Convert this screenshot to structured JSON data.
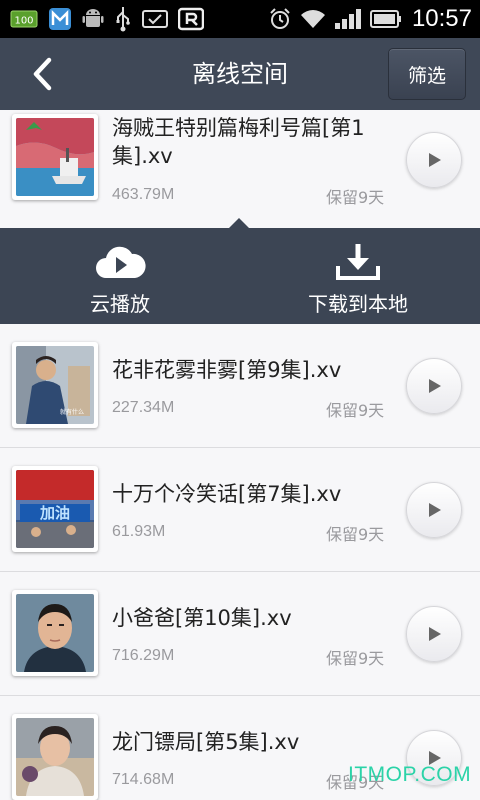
{
  "status_bar": {
    "battery_badge": "100",
    "time": "10:57"
  },
  "header": {
    "title": "离线空间",
    "filter_label": "筛选"
  },
  "action_panel": {
    "cloud_play_label": "云播放",
    "download_label": "下载到本地"
  },
  "items": [
    {
      "title": "海贼王特别篇梅利号篇[第1集].xv",
      "size": "463.79M",
      "keep": "保留9天"
    },
    {
      "title": "花非花雾非雾[第9集].xv",
      "size": "227.34M",
      "keep": "保留9天"
    },
    {
      "title": "十万个冷笑话[第7集].xv",
      "size": "61.93M",
      "keep": "保留9天"
    },
    {
      "title": "小爸爸[第10集].xv",
      "size": "716.29M",
      "keep": "保留9天"
    },
    {
      "title": "龙门镖局[第5集].xv",
      "size": "714.68M",
      "keep": "保留9天"
    }
  ],
  "watermark": "ITMOP.COM",
  "colors": {
    "header_bg": "#3f4857",
    "panel_bg": "#3c4554",
    "list_bg": "#f7f7f9",
    "watermark": "#2bd3a8"
  }
}
